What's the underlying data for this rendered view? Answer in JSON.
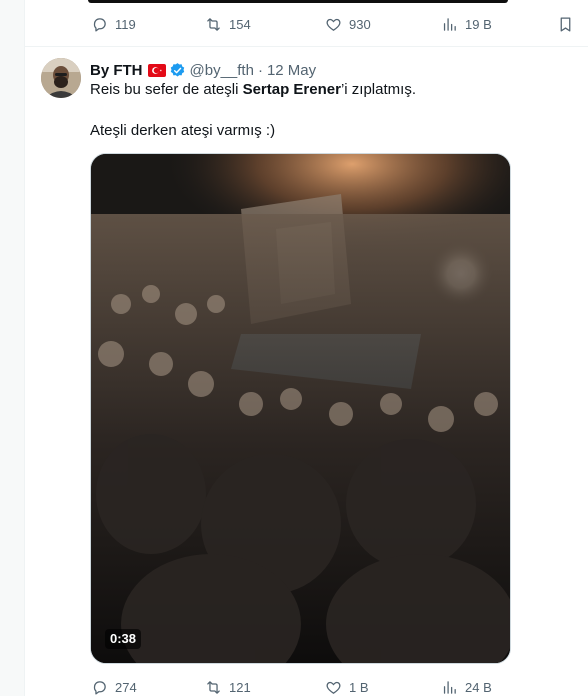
{
  "prev_tweet": {
    "replies": "119",
    "retweets": "154",
    "likes": "930",
    "views": "19 B"
  },
  "tweet": {
    "display_name": "By FTH",
    "handle": "@by__fth",
    "separator": "·",
    "date": "12 May",
    "text_line1_prefix": "Reis bu sefer de ateşli ",
    "text_line1_bold": "Sertap Erener",
    "text_line1_suffix": "’i zıplatmış.",
    "text_line2": "Ateşli derken ateşi varmış :)",
    "video_duration": "0:38",
    "replies": "274",
    "retweets": "121",
    "likes": "1 B",
    "views": "24 B"
  },
  "icons": {
    "reply": "reply-icon",
    "retweet": "retweet-icon",
    "like": "heart-icon",
    "views": "views-icon",
    "bookmark": "bookmark-icon",
    "verified": "verified-badge-icon",
    "flag": "turkey-flag-icon"
  },
  "colors": {
    "secondary_text": "#536471",
    "verified_blue": "#1d9bf0",
    "flag_red": "#e30a17"
  }
}
